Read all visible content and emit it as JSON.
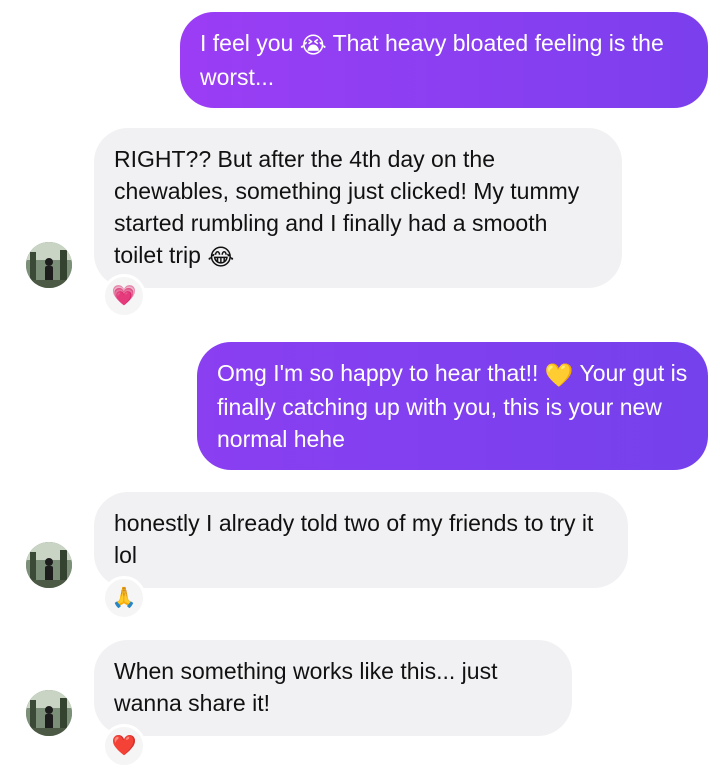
{
  "messages": [
    {
      "direction": "outgoing",
      "text_before": "I feel you ",
      "emoji": "😭",
      "text_after": " That heavy bloated feeling is the worst..."
    },
    {
      "direction": "incoming",
      "text_before": "RIGHT?? But after the 4th day on the chewables, something just clicked! My tummy started rumbling and I finally had a smooth toilet trip ",
      "emoji": "😂",
      "text_after": "",
      "reaction": "💗"
    },
    {
      "direction": "outgoing",
      "text_before": "Omg I'm so happy to hear that!! ",
      "emoji": "💛",
      "text_after": " Your gut is finally catching up with you, this is your new normal hehe"
    },
    {
      "direction": "incoming",
      "text_before": "honestly I already told two of my friends to try it lol",
      "emoji": "",
      "text_after": "",
      "reaction": "🙏"
    },
    {
      "direction": "incoming",
      "text_before": "When something works like this... just wanna share it!",
      "emoji": "",
      "text_after": "",
      "reaction": "❤️"
    }
  ],
  "colors": {
    "outgoing_bubble": "#8a3ff1",
    "incoming_bubble": "#f1f1f3",
    "reaction_bg": "#f5f5f6"
  }
}
